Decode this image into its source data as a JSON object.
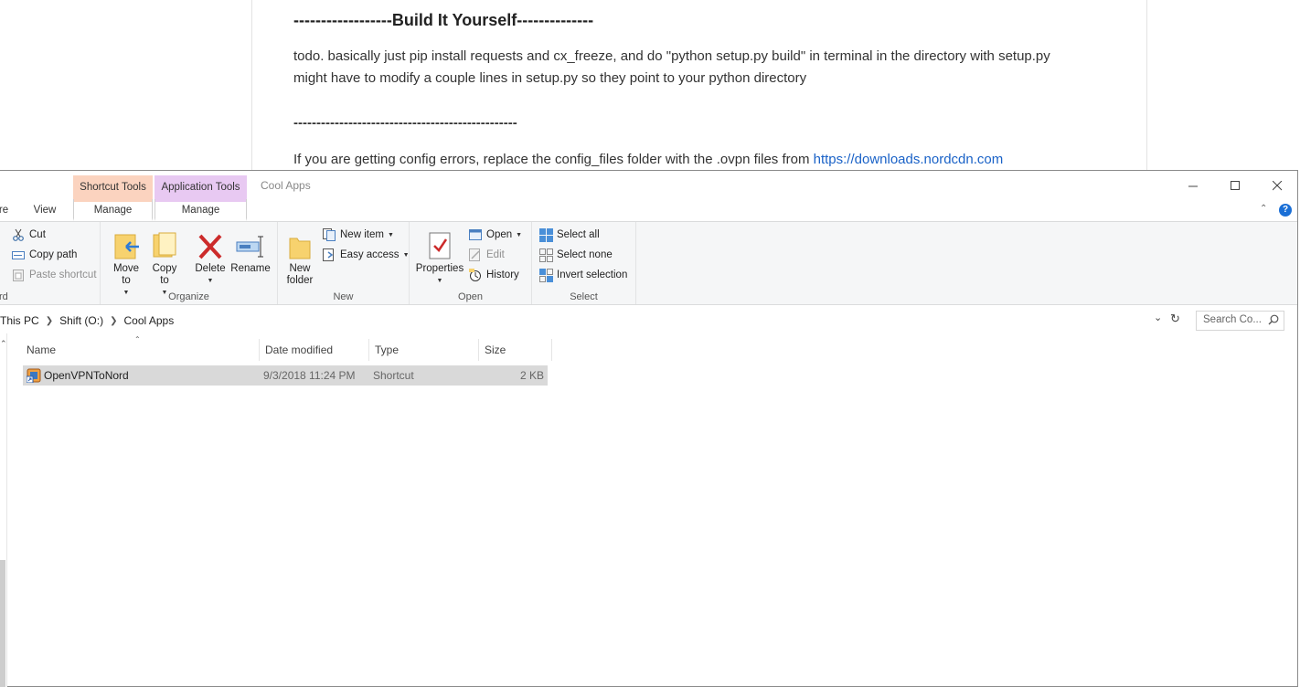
{
  "document": {
    "heading": "------------------Build It Yourself--------------",
    "line1": "todo. basically just pip install requests and cx_freeze, and do \"python setup.py build\" in terminal in the directory with setup.py",
    "line2": "might have to modify a couple lines in setup.py so they point to your python directory",
    "divider": "-------------------------------------------------",
    "line3": "If you are getting config errors, replace the config_files folder with the .ovpn files from ",
    "link": "https://downloads.nordcdn.com"
  },
  "window": {
    "title": "Cool Apps",
    "context_tabs": {
      "shortcut_tools": "Shortcut Tools",
      "application_tools": "Application Tools"
    },
    "ribbon_tabs": {
      "share_partial": "re",
      "view": "View",
      "manage_shortcut": "Manage",
      "manage_app": "Manage"
    }
  },
  "ribbon": {
    "clipboard": {
      "cut": "Cut",
      "copy_path": "Copy path",
      "paste_shortcut": "Paste shortcut",
      "label_partial": "rd"
    },
    "organize": {
      "move_to": "Move\nto",
      "copy_to": "Copy\nto",
      "delete": "Delete",
      "rename": "Rename",
      "label": "Organize"
    },
    "new": {
      "new_folder": "New\nfolder",
      "new_item": "New item",
      "easy_access": "Easy access",
      "label": "New"
    },
    "open": {
      "properties": "Properties",
      "open": "Open",
      "edit": "Edit",
      "history": "History",
      "label": "Open"
    },
    "select": {
      "select_all": "Select all",
      "select_none": "Select none",
      "invert_selection": "Invert selection",
      "label": "Select"
    }
  },
  "address": {
    "crumbs": [
      "This PC",
      "Shift (O:)",
      "Cool Apps"
    ],
    "search_placeholder": "Search Co..."
  },
  "columns": {
    "name": "Name",
    "date": "Date modified",
    "type": "Type",
    "size": "Size"
  },
  "files": [
    {
      "name": "OpenVPNToNord",
      "date": "9/3/2018 11:24 PM",
      "type": "Shortcut",
      "size": "2 KB"
    }
  ],
  "colors": {
    "shortcut_tools": "#fbd3bf",
    "application_tools": "#e8c9f2",
    "link": "#1a62c7",
    "selected_row": "#d9d9d9"
  }
}
